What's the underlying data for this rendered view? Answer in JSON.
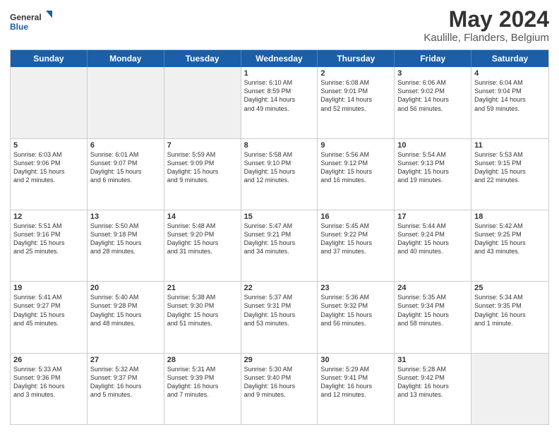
{
  "logo": {
    "line1": "General",
    "line2": "Blue"
  },
  "title": "May 2024",
  "subtitle": "Kaulille, Flanders, Belgium",
  "header_days": [
    "Sunday",
    "Monday",
    "Tuesday",
    "Wednesday",
    "Thursday",
    "Friday",
    "Saturday"
  ],
  "weeks": [
    [
      {
        "day": "",
        "info": "",
        "shaded": true
      },
      {
        "day": "",
        "info": "",
        "shaded": true
      },
      {
        "day": "",
        "info": "",
        "shaded": true
      },
      {
        "day": "1",
        "info": "Sunrise: 6:10 AM\nSunset: 8:59 PM\nDaylight: 14 hours\nand 49 minutes."
      },
      {
        "day": "2",
        "info": "Sunrise: 6:08 AM\nSunset: 9:01 PM\nDaylight: 14 hours\nand 52 minutes."
      },
      {
        "day": "3",
        "info": "Sunrise: 6:06 AM\nSunset: 9:02 PM\nDaylight: 14 hours\nand 56 minutes."
      },
      {
        "day": "4",
        "info": "Sunrise: 6:04 AM\nSunset: 9:04 PM\nDaylight: 14 hours\nand 59 minutes."
      }
    ],
    [
      {
        "day": "5",
        "info": "Sunrise: 6:03 AM\nSunset: 9:06 PM\nDaylight: 15 hours\nand 2 minutes."
      },
      {
        "day": "6",
        "info": "Sunrise: 6:01 AM\nSunset: 9:07 PM\nDaylight: 15 hours\nand 6 minutes."
      },
      {
        "day": "7",
        "info": "Sunrise: 5:59 AM\nSunset: 9:09 PM\nDaylight: 15 hours\nand 9 minutes."
      },
      {
        "day": "8",
        "info": "Sunrise: 5:58 AM\nSunset: 9:10 PM\nDaylight: 15 hours\nand 12 minutes."
      },
      {
        "day": "9",
        "info": "Sunrise: 5:56 AM\nSunset: 9:12 PM\nDaylight: 15 hours\nand 16 minutes."
      },
      {
        "day": "10",
        "info": "Sunrise: 5:54 AM\nSunset: 9:13 PM\nDaylight: 15 hours\nand 19 minutes."
      },
      {
        "day": "11",
        "info": "Sunrise: 5:53 AM\nSunset: 9:15 PM\nDaylight: 15 hours\nand 22 minutes."
      }
    ],
    [
      {
        "day": "12",
        "info": "Sunrise: 5:51 AM\nSunset: 9:16 PM\nDaylight: 15 hours\nand 25 minutes."
      },
      {
        "day": "13",
        "info": "Sunrise: 5:50 AM\nSunset: 9:18 PM\nDaylight: 15 hours\nand 28 minutes."
      },
      {
        "day": "14",
        "info": "Sunrise: 5:48 AM\nSunset: 9:20 PM\nDaylight: 15 hours\nand 31 minutes."
      },
      {
        "day": "15",
        "info": "Sunrise: 5:47 AM\nSunset: 9:21 PM\nDaylight: 15 hours\nand 34 minutes."
      },
      {
        "day": "16",
        "info": "Sunrise: 5:45 AM\nSunset: 9:22 PM\nDaylight: 15 hours\nand 37 minutes."
      },
      {
        "day": "17",
        "info": "Sunrise: 5:44 AM\nSunset: 9:24 PM\nDaylight: 15 hours\nand 40 minutes."
      },
      {
        "day": "18",
        "info": "Sunrise: 5:42 AM\nSunset: 9:25 PM\nDaylight: 15 hours\nand 43 minutes."
      }
    ],
    [
      {
        "day": "19",
        "info": "Sunrise: 5:41 AM\nSunset: 9:27 PM\nDaylight: 15 hours\nand 45 minutes."
      },
      {
        "day": "20",
        "info": "Sunrise: 5:40 AM\nSunset: 9:28 PM\nDaylight: 15 hours\nand 48 minutes."
      },
      {
        "day": "21",
        "info": "Sunrise: 5:38 AM\nSunset: 9:30 PM\nDaylight: 15 hours\nand 51 minutes."
      },
      {
        "day": "22",
        "info": "Sunrise: 5:37 AM\nSunset: 9:31 PM\nDaylight: 15 hours\nand 53 minutes."
      },
      {
        "day": "23",
        "info": "Sunrise: 5:36 AM\nSunset: 9:32 PM\nDaylight: 15 hours\nand 56 minutes."
      },
      {
        "day": "24",
        "info": "Sunrise: 5:35 AM\nSunset: 9:34 PM\nDaylight: 15 hours\nand 58 minutes."
      },
      {
        "day": "25",
        "info": "Sunrise: 5:34 AM\nSunset: 9:35 PM\nDaylight: 16 hours\nand 1 minute."
      }
    ],
    [
      {
        "day": "26",
        "info": "Sunrise: 5:33 AM\nSunset: 9:36 PM\nDaylight: 16 hours\nand 3 minutes."
      },
      {
        "day": "27",
        "info": "Sunrise: 5:32 AM\nSunset: 9:37 PM\nDaylight: 16 hours\nand 5 minutes."
      },
      {
        "day": "28",
        "info": "Sunrise: 5:31 AM\nSunset: 9:39 PM\nDaylight: 16 hours\nand 7 minutes."
      },
      {
        "day": "29",
        "info": "Sunrise: 5:30 AM\nSunset: 9:40 PM\nDaylight: 16 hours\nand 9 minutes."
      },
      {
        "day": "30",
        "info": "Sunrise: 5:29 AM\nSunset: 9:41 PM\nDaylight: 16 hours\nand 12 minutes."
      },
      {
        "day": "31",
        "info": "Sunrise: 5:28 AM\nSunset: 9:42 PM\nDaylight: 16 hours\nand 13 minutes."
      },
      {
        "day": "",
        "info": "",
        "shaded": true
      }
    ]
  ]
}
